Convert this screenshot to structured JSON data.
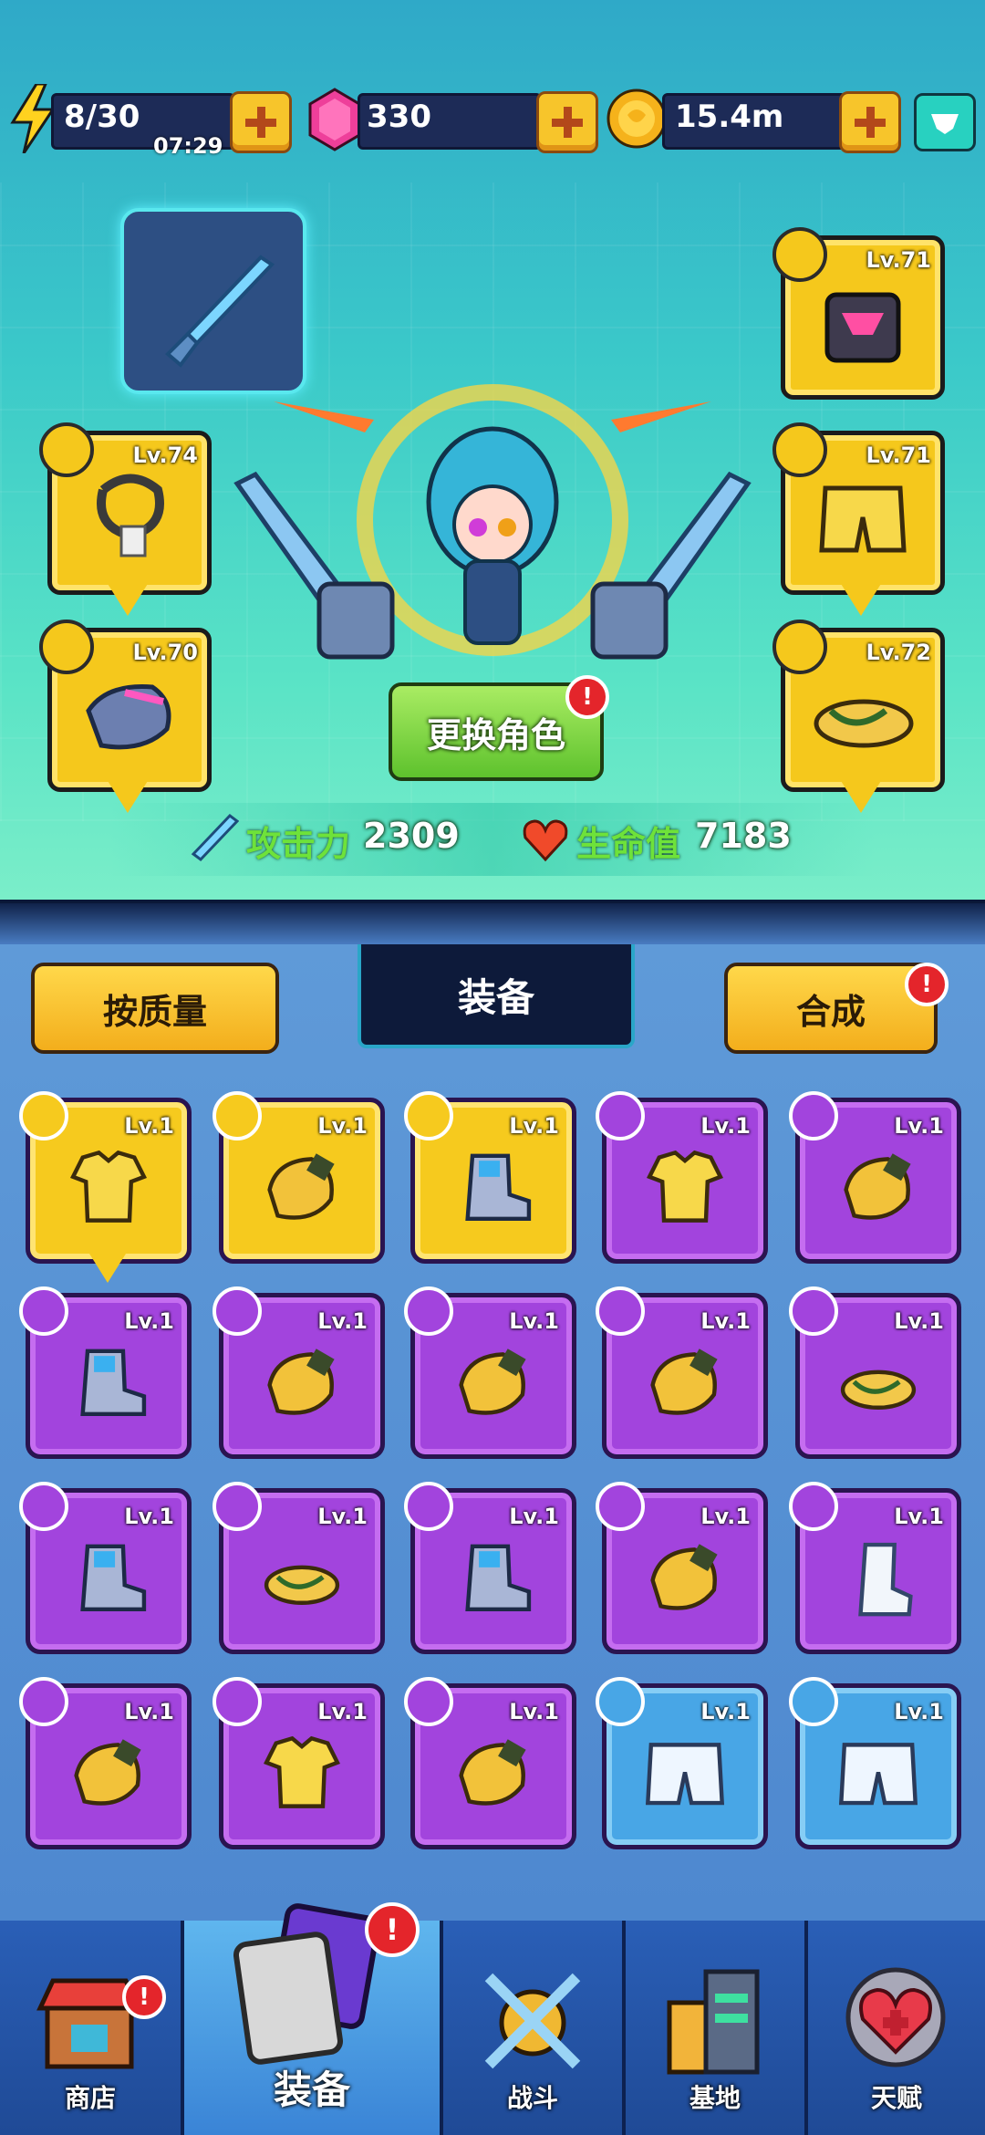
{
  "resources": {
    "energy": "8/30",
    "energy_timer": "07:29",
    "gems": "330",
    "coins": "15.4m"
  },
  "hero": {
    "change_character_label": "更换角色",
    "attack_label": "攻击力",
    "attack_value": "2309",
    "hp_label": "生命值",
    "hp_value": "7183",
    "slots": [
      {
        "level": "Lv.74"
      },
      {
        "level": "Lv.70"
      },
      {
        "level": "Lv.71"
      },
      {
        "level": "Lv.71"
      },
      {
        "level": "Lv.72"
      }
    ]
  },
  "inventory": {
    "sort_label": "按质量",
    "title": "装备",
    "merge_label": "合成",
    "items": [
      {
        "level": "Lv.1",
        "rarity": "gold",
        "icon": "shirt-icon"
      },
      {
        "level": "Lv.1",
        "rarity": "gold",
        "icon": "glove-icon"
      },
      {
        "level": "Lv.1",
        "rarity": "gold",
        "icon": "boot-icon"
      },
      {
        "level": "Lv.1",
        "rarity": "purple",
        "icon": "shirt-icon"
      },
      {
        "level": "Lv.1",
        "rarity": "purple",
        "icon": "glove-icon"
      },
      {
        "level": "Lv.1",
        "rarity": "purple",
        "icon": "boot-icon"
      },
      {
        "level": "Lv.1",
        "rarity": "purple",
        "icon": "glove-icon"
      },
      {
        "level": "Lv.1",
        "rarity": "purple",
        "icon": "glove-icon"
      },
      {
        "level": "Lv.1",
        "rarity": "purple",
        "icon": "glove-icon"
      },
      {
        "level": "Lv.1",
        "rarity": "purple",
        "icon": "sandal-icon"
      },
      {
        "level": "Lv.1",
        "rarity": "purple",
        "icon": "boot-icon"
      },
      {
        "level": "Lv.1",
        "rarity": "purple",
        "icon": "sandal-icon"
      },
      {
        "level": "Lv.1",
        "rarity": "purple",
        "icon": "boot-icon"
      },
      {
        "level": "Lv.1",
        "rarity": "purple",
        "icon": "glove-icon"
      },
      {
        "level": "Lv.1",
        "rarity": "purple",
        "icon": "sock-icon"
      },
      {
        "level": "Lv.1",
        "rarity": "purple",
        "icon": "glove-icon"
      },
      {
        "level": "Lv.1",
        "rarity": "purple",
        "icon": "shirt-icon"
      },
      {
        "level": "Lv.1",
        "rarity": "purple",
        "icon": "glove-icon"
      },
      {
        "level": "Lv.1",
        "rarity": "blue",
        "icon": "shorts-icon"
      },
      {
        "level": "Lv.1",
        "rarity": "blue",
        "icon": "shorts-icon"
      }
    ]
  },
  "nav": {
    "shop": "商店",
    "equipment": "装备",
    "battle": "战斗",
    "base": "基地",
    "talent": "天赋"
  },
  "colors": {
    "gold": "#f6ca1e",
    "purple": "#a244dd",
    "blue": "#48a6e6",
    "alert": "#e4252b"
  }
}
